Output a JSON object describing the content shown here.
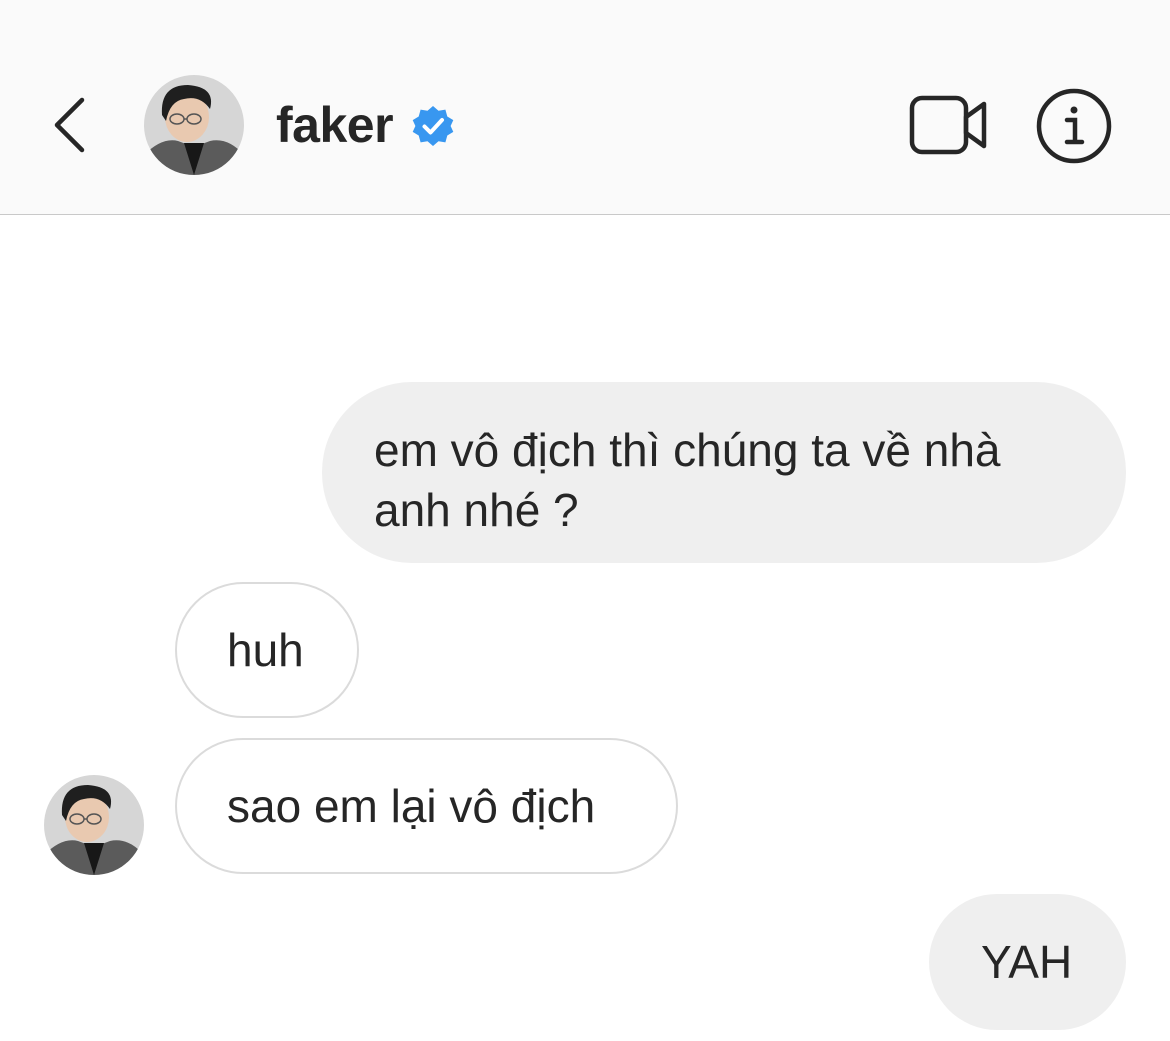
{
  "header": {
    "username": "faker",
    "verified": true,
    "icons": {
      "back": "chevron-left-icon",
      "verified": "verified-badge-icon",
      "video_call": "video-camera-icon",
      "info": "info-icon"
    }
  },
  "messages": [
    {
      "direction": "sent",
      "text": "em vô địch thì chúng ta về nhà\nanh nhé ?"
    },
    {
      "direction": "received",
      "text": "huh"
    },
    {
      "direction": "received",
      "text": "sao em lại vô địch"
    },
    {
      "direction": "sent",
      "text": "YAH"
    }
  ],
  "colors": {
    "header_bg": "#fafafa",
    "sent_bubble": "#efefef",
    "received_border": "#dbdbdb",
    "verified_blue": "#3897f0",
    "text": "#262626"
  }
}
